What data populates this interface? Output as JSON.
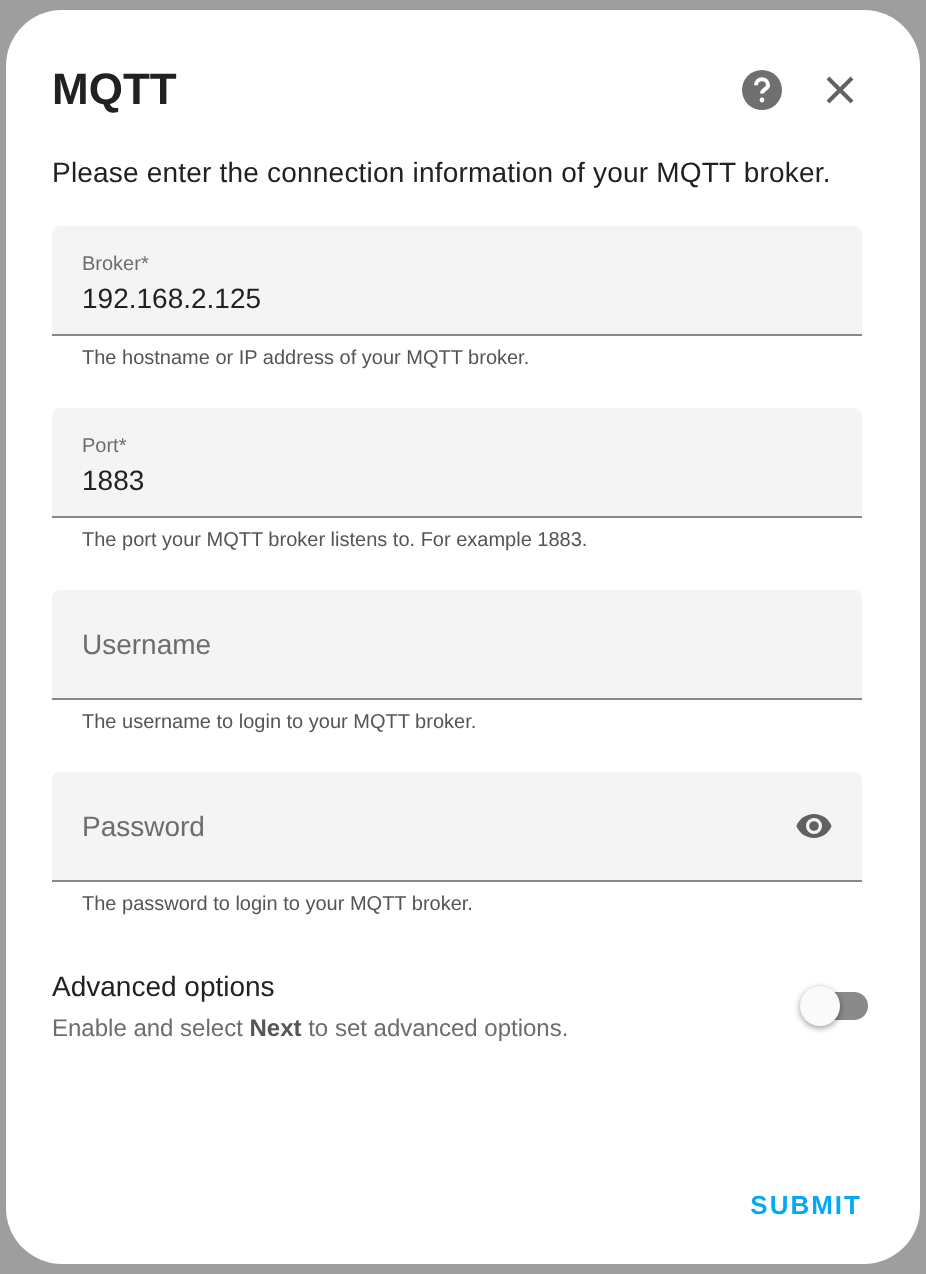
{
  "dialog": {
    "title": "MQTT",
    "description": "Please enter the connection information of your MQTT broker.",
    "fields": [
      {
        "kind": "text",
        "label": "Broker*",
        "value": "192.168.2.125",
        "helper": "The hostname or IP address of your MQTT broker."
      },
      {
        "kind": "text",
        "label": "Port*",
        "value": "1883",
        "helper": "The port your MQTT broker listens to. For example 1883."
      },
      {
        "kind": "text",
        "placeholder": "Username",
        "helper": "The username to login to your MQTT broker."
      },
      {
        "kind": "password",
        "placeholder": "Password",
        "helper": "The password to login to your MQTT broker."
      }
    ],
    "advanced": {
      "title": "Advanced options",
      "description": "Enable and select **Next** to set advanced options.",
      "on": false
    },
    "submit": "SUBMIT"
  }
}
